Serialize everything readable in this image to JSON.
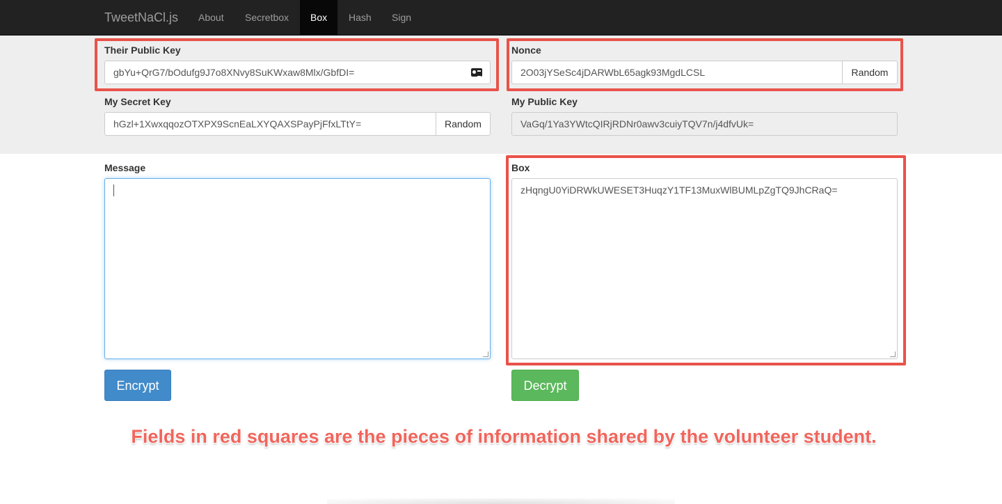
{
  "navbar": {
    "brand": "TweetNaCl.js",
    "items": [
      {
        "label": "About"
      },
      {
        "label": "Secretbox"
      },
      {
        "label": "Box"
      },
      {
        "label": "Hash"
      },
      {
        "label": "Sign"
      }
    ],
    "active": "Box"
  },
  "keys": {
    "their_public_key": {
      "label": "Their Public Key",
      "value": "gbYu+QrG7/bOdufg9J7o8XNvy8SuKWxaw8Mlx/GbfDI=",
      "icon": "id-card-icon"
    },
    "nonce": {
      "label": "Nonce",
      "value": "2O03jYSeSc4jDARWbL65agk93MgdLCSL",
      "button": "Random"
    },
    "my_secret_key": {
      "label": "My Secret Key",
      "value": "hGzl+1XwxqqozOTXPX9ScnEaLXYQAXSPayPjFfxLTtY=",
      "button": "Random"
    },
    "my_public_key": {
      "label": "My Public Key",
      "value": "VaGq/1Ya3YWtcQIRjRDNr0awv3cuiyTQV7n/j4dfvUk="
    }
  },
  "message": {
    "label": "Message",
    "value": ""
  },
  "box": {
    "label": "Box",
    "value": "zHqngU0YiDRWkUWESET3HuqzY1TF13MuxWlBUMLpZgTQ9JhCRaQ="
  },
  "actions": {
    "encrypt": "Encrypt",
    "decrypt": "Decrypt"
  },
  "annotation": "Fields in red squares are the pieces of information shared by the volunteer student.",
  "colors": {
    "highlight": "#e8534a",
    "encrypt": "#428bca",
    "decrypt": "#5cb85c",
    "navbar": "#222222"
  }
}
